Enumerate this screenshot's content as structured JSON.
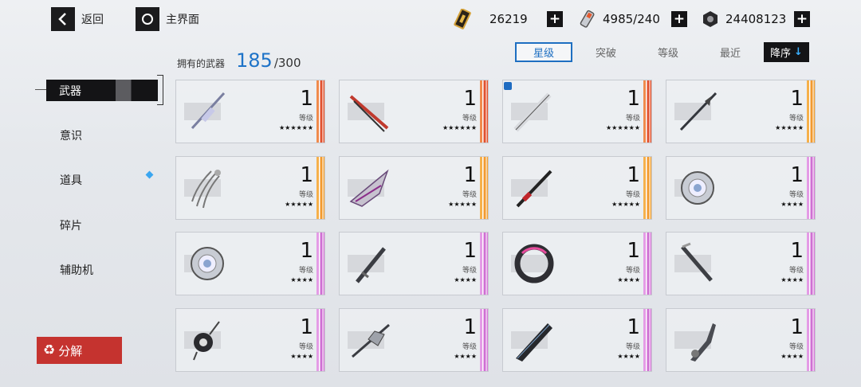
{
  "nav": {
    "back_label": "返回",
    "home_label": "主界面"
  },
  "resources": [
    {
      "icon": "ticket-icon",
      "value": "26219"
    },
    {
      "icon": "battery-icon",
      "value": "4985/240"
    },
    {
      "icon": "coin-icon",
      "value": "24408123"
    }
  ],
  "owned": {
    "label": "拥有的武器",
    "count": "185",
    "max": "/300"
  },
  "sort_tabs": [
    {
      "label": "星级",
      "active": true
    },
    {
      "label": "突破",
      "active": false
    },
    {
      "label": "等级",
      "active": false
    },
    {
      "label": "最近",
      "active": false
    }
  ],
  "order_button": "降序",
  "sidebar": {
    "items": [
      {
        "label": "武器",
        "active": true
      },
      {
        "label": "意识",
        "active": false
      },
      {
        "label": "道具",
        "active": false
      },
      {
        "label": "碎片",
        "active": false
      },
      {
        "label": "辅助机",
        "active": false
      }
    ],
    "recycle_label": "分解"
  },
  "weapons": [
    {
      "level": "1",
      "level_label": "等级",
      "stars": "★★★★★★",
      "rarity": "red",
      "locked": false,
      "art": "lance"
    },
    {
      "level": "1",
      "level_label": "等级",
      "stars": "★★★★★★",
      "rarity": "red",
      "locked": false,
      "art": "katana-red"
    },
    {
      "level": "1",
      "level_label": "等级",
      "stars": "★★★★★★",
      "rarity": "red",
      "locked": true,
      "art": "blade-white"
    },
    {
      "level": "1",
      "level_label": "等级",
      "stars": "★★★★★",
      "rarity": "orange",
      "locked": false,
      "art": "spear-dark"
    },
    {
      "level": "1",
      "level_label": "等级",
      "stars": "★★★★★",
      "rarity": "orange",
      "locked": false,
      "art": "claw"
    },
    {
      "level": "1",
      "level_label": "等级",
      "stars": "★★★★★",
      "rarity": "orange",
      "locked": false,
      "art": "blade-wing"
    },
    {
      "level": "1",
      "level_label": "等级",
      "stars": "★★★★★",
      "rarity": "orange",
      "locked": false,
      "art": "katana-black"
    },
    {
      "level": "1",
      "level_label": "等级",
      "stars": "★★★★",
      "rarity": "purple",
      "locked": false,
      "art": "flower-disc"
    },
    {
      "level": "1",
      "level_label": "等级",
      "stars": "★★★★",
      "rarity": "purple",
      "locked": false,
      "art": "flower-disc"
    },
    {
      "level": "1",
      "level_label": "等级",
      "stars": "★★★★",
      "rarity": "purple",
      "locked": false,
      "art": "dagger"
    },
    {
      "level": "1",
      "level_label": "等级",
      "stars": "★★★★",
      "rarity": "purple",
      "locked": false,
      "art": "ring"
    },
    {
      "level": "1",
      "level_label": "等级",
      "stars": "★★★★",
      "rarity": "purple",
      "locked": false,
      "art": "baton"
    },
    {
      "level": "1",
      "level_label": "等级",
      "stars": "★★★★",
      "rarity": "purple",
      "locked": false,
      "art": "bot"
    },
    {
      "level": "1",
      "level_label": "等级",
      "stars": "★★★★",
      "rarity": "purple",
      "locked": false,
      "art": "axe"
    },
    {
      "level": "1",
      "level_label": "等级",
      "stars": "★★★★",
      "rarity": "purple",
      "locked": false,
      "art": "broadblade"
    },
    {
      "level": "1",
      "level_label": "等级",
      "stars": "★★★★",
      "rarity": "purple",
      "locked": false,
      "art": "gun-blade"
    }
  ]
}
